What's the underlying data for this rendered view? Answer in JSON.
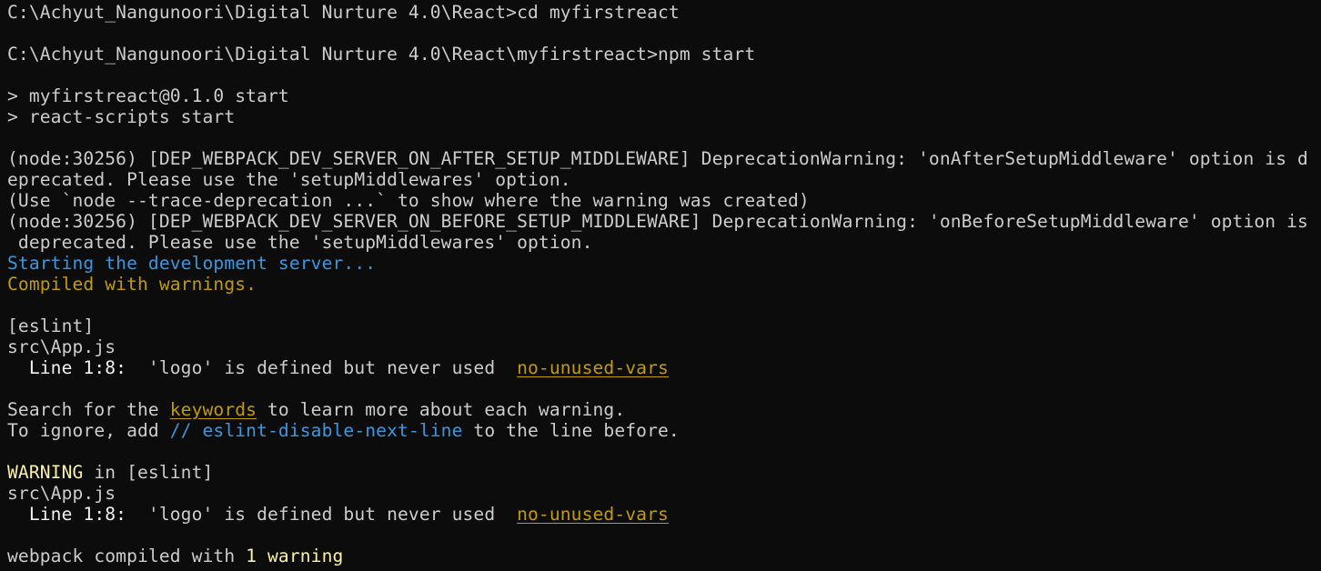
{
  "colors": {
    "background": "#0c0c0c",
    "foreground": "#cccccc",
    "info_blue": "#3a96dd",
    "warning_yellow": "#c19c00",
    "highlight_yellow": "#f9f1a5"
  },
  "lines": {
    "l1": "C:\\Achyut_Nangunoori\\Digital Nurture 4.0\\React>cd myfirstreact",
    "l3": "C:\\Achyut_Nangunoori\\Digital Nurture 4.0\\React\\myfirstreact>npm start",
    "l5": "> myfirstreact@0.1.0 start",
    "l6": "> react-scripts start",
    "l8": "(node:30256) [DEP_WEBPACK_DEV_SERVER_ON_AFTER_SETUP_MIDDLEWARE] DeprecationWarning: 'onAfterSetupMiddleware' option is d",
    "l9": "eprecated. Please use the 'setupMiddlewares' option.",
    "l10": "(Use `node --trace-deprecation ...` to show where the warning was created)",
    "l11": "(node:30256) [DEP_WEBPACK_DEV_SERVER_ON_BEFORE_SETUP_MIDDLEWARE] DeprecationWarning: 'onBeforeSetupMiddleware' option is",
    "l12": " deprecated. Please use the 'setupMiddlewares' option.",
    "l13": "Starting the development server...",
    "l14": "Compiled with warnings.",
    "l16": "[eslint]",
    "l17": "src\\App.js",
    "l18_line": "Line 1:8:",
    "l18_msg": "  'logo' is defined but never used  ",
    "l18_rule": "no-unused-vars",
    "l20_a": "Search for the ",
    "l20_kw": "keywords",
    "l20_b": " to learn more about each warning.",
    "l21_a": "To ignore, add ",
    "l21_cmd": "// eslint-disable-next-line",
    "l21_b": " to the line before.",
    "l23_warn": "WARNING",
    "l23_rest": " in [eslint]",
    "l24": "src\\App.js",
    "l25_line": "Line 1:8:",
    "l25_msg": "  'logo' is defined but never used  ",
    "l25_rule": "no-unused-vars",
    "l27_a": "webpack compiled with ",
    "l27_count": "1 warning"
  }
}
